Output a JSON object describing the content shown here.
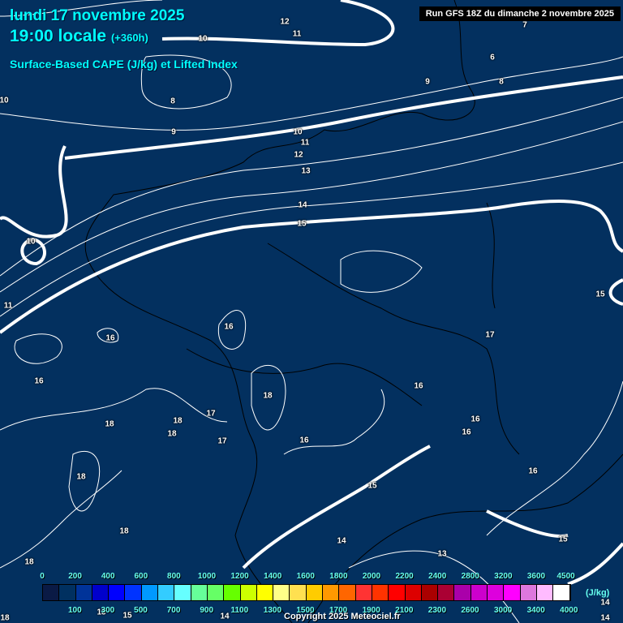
{
  "header": {
    "date": "lundi 17 novembre 2025",
    "time": "19:00 locale",
    "lead": "(+360h)",
    "parameter": "Surface-Based CAPE (J/kg) et Lifted Index",
    "run": "Run GFS 18Z du dimanche 2 novembre 2025"
  },
  "contour_labels": [
    "12",
    "11",
    "10",
    "7",
    "6",
    "9",
    "8",
    "8",
    "10",
    "9",
    "10",
    "11",
    "12",
    "13",
    "14",
    "15",
    "10",
    "15",
    "11",
    "16",
    "16",
    "17",
    "16",
    "16",
    "18",
    "17",
    "18",
    "18",
    "18",
    "16",
    "16",
    "17",
    "16",
    "18",
    "16",
    "15",
    "18",
    "14",
    "15",
    "13",
    "18",
    "14",
    "14",
    "18",
    "14",
    "15",
    "13"
  ],
  "legend": {
    "unit": "(J/kg)",
    "top_ticks": [
      "0",
      "200",
      "400",
      "600",
      "800",
      "1000",
      "1200",
      "1400",
      "1600",
      "1800",
      "2000",
      "2200",
      "2400",
      "2800",
      "3200",
      "3600",
      "4500"
    ],
    "bottom_ticks": [
      "100",
      "300",
      "500",
      "700",
      "900",
      "1100",
      "1300",
      "1500",
      "1700",
      "1900",
      "2100",
      "2300",
      "2600",
      "3000",
      "3400",
      "4000"
    ],
    "colors": [
      "#0a1a45",
      "#003060",
      "#003399",
      "#0000cc",
      "#0000ff",
      "#0033ff",
      "#0099ff",
      "#33ccff",
      "#66ffff",
      "#66ff99",
      "#66ff66",
      "#66ff00",
      "#ccff00",
      "#ffff00",
      "#ffff88",
      "#ffe050",
      "#ffcc00",
      "#ff9900",
      "#ff6600",
      "#ff3333",
      "#ff3300",
      "#ff0000",
      "#dd0000",
      "#aa0000",
      "#aa0033",
      "#aa00aa",
      "#cc00cc",
      "#dd00dd",
      "#ff00ff",
      "#dd77dd",
      "#ffbbff",
      "#ffffff"
    ]
  },
  "copyright": "Copyright 2025 Meteociel.fr"
}
